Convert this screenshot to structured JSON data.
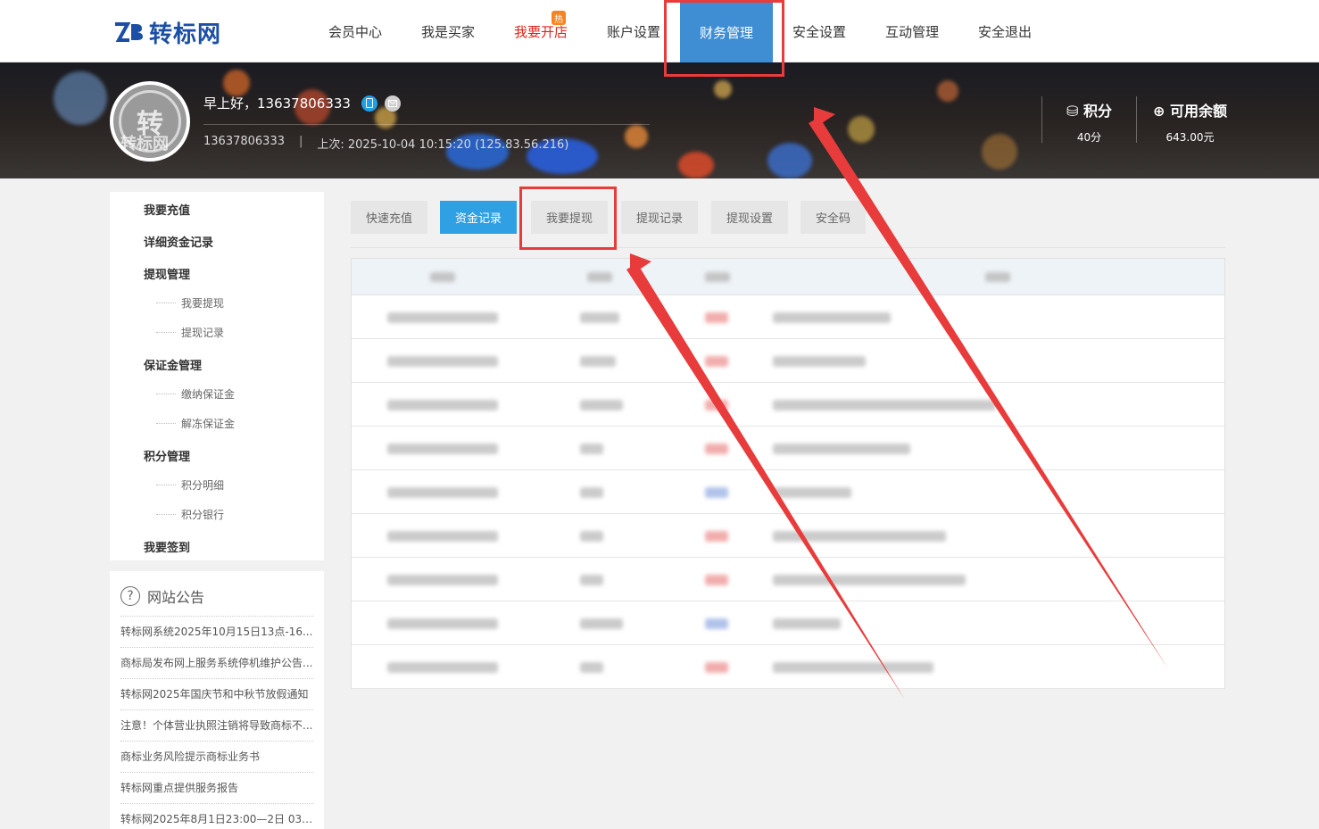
{
  "header": {
    "logo_text": "转标网",
    "nav": [
      {
        "label": "会员中心"
      },
      {
        "label": "我是买家"
      },
      {
        "label": "我要开店",
        "badge": "热"
      },
      {
        "label": "账户设置"
      },
      {
        "label": "财务管理"
      },
      {
        "label": "安全设置"
      },
      {
        "label": "互动管理"
      },
      {
        "label": "安全退出"
      }
    ]
  },
  "profile": {
    "avatar_text": "转",
    "avatar_watermark": "转标网",
    "greeting": "早上好，13637806333",
    "username": "13637806333",
    "last_login": "上次: 2025-10-04 10:15:20 (125.83.56.216)",
    "points_label": "积分",
    "points_value": "40分",
    "balance_label": "可用余额",
    "balance_value": "643.00元"
  },
  "sidebar": {
    "groups": [
      {
        "label": "我要充值"
      },
      {
        "label": "详细资金记录"
      },
      {
        "label": "提现管理",
        "items": [
          "我要提现",
          "提现记录"
        ]
      },
      {
        "label": "保证金管理",
        "items": [
          "缴纳保证金",
          "解冻保证金"
        ]
      },
      {
        "label": "积分管理",
        "items": [
          "积分明细",
          "积分银行"
        ]
      },
      {
        "label": "我要签到"
      }
    ]
  },
  "notice": {
    "title": "网站公告",
    "items": [
      "转标网系统2025年10月15日13点-16...",
      "商标局发布网上服务系统停机维护公告...",
      "转标网2025年国庆节和中秋节放假通知",
      "注意！个体营业执照注销将导致商标不...",
      "商标业务风险提示商标业务书",
      "转标网重点提供服务报告",
      "转标网2025年8月1日23:00—2日 03:0..."
    ]
  },
  "tabs": [
    {
      "label": "快速充值"
    },
    {
      "label": "资金记录",
      "active": true
    },
    {
      "label": "我要提现"
    },
    {
      "label": "提现记录"
    },
    {
      "label": "提现设置"
    },
    {
      "label": "安全码"
    }
  ],
  "table": {
    "row_count": 9,
    "amount_colors": [
      "red",
      "red",
      "red",
      "red",
      "blue",
      "red",
      "red",
      "blue",
      "red"
    ]
  },
  "colors": {
    "accent": "#2fa0e4",
    "nav_active": "#3f8ed4",
    "highlight": "#e83b3b",
    "brand": "#1a4fa5"
  }
}
